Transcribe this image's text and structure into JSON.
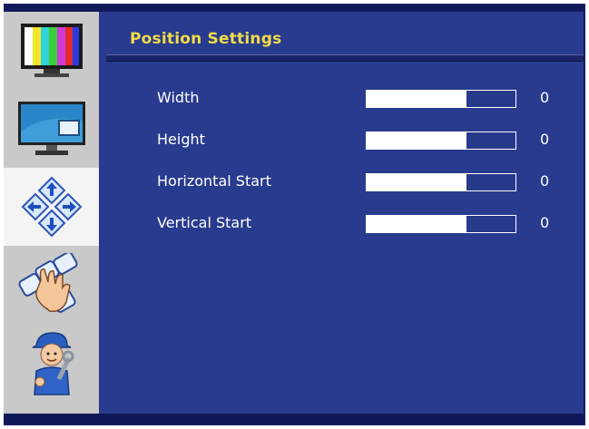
{
  "osd": {
    "title": "Position Settings",
    "menu_icons": [
      "color-bars-icon",
      "monitor-icon",
      "position-arrows-icon",
      "keypad-hand-icon",
      "technician-icon"
    ],
    "active_menu_index": 2,
    "settings": [
      {
        "label": "Width",
        "value": "0",
        "level": 0.67
      },
      {
        "label": "Height",
        "value": "0",
        "level": 0.67
      },
      {
        "label": "Horizontal Start",
        "value": "0",
        "level": 0.67
      },
      {
        "label": "Vertical Start",
        "value": "0",
        "level": 0.67
      }
    ]
  },
  "colors": {
    "panel": "#283b8e",
    "frame": "#101a5a",
    "title": "#f2dc48",
    "sidebar": "#c9c9c9",
    "sidebar_active": "#f4f4f4"
  }
}
